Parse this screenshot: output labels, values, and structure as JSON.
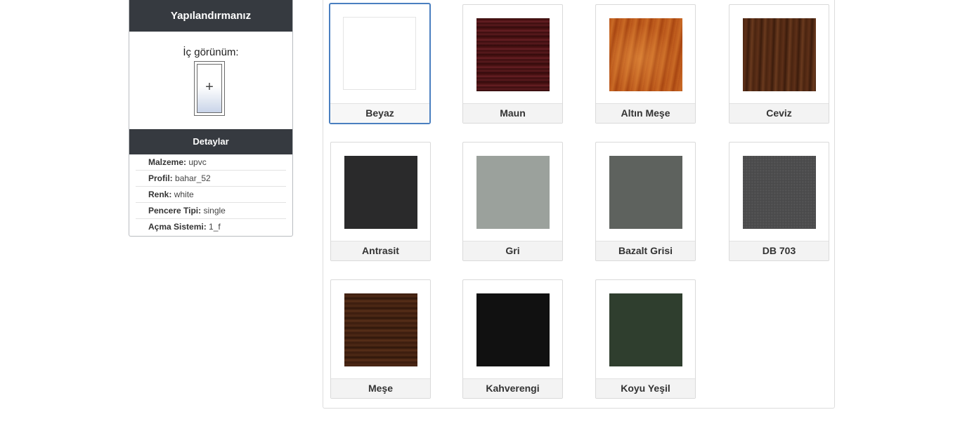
{
  "config": {
    "title": "Yapılandırmanız",
    "view_label": "İç görünüm:",
    "window_plus": "+",
    "details_title": "Detaylar",
    "details": [
      {
        "key": "Malzeme:",
        "value": "upvc"
      },
      {
        "key": "Profil:",
        "value": "bahar_52"
      },
      {
        "key": "Renk:",
        "value": "white"
      },
      {
        "key": "Pencere Tipi:",
        "value": "single"
      },
      {
        "key": "Açma Sistemi:",
        "value": "1_f"
      }
    ]
  },
  "colors": {
    "selected": "Beyaz",
    "items": [
      {
        "label": "Beyaz",
        "swatch": "#ffffff"
      },
      {
        "label": "Maun",
        "swatch": "#4a1214"
      },
      {
        "label": "Altın Meşe",
        "swatch": "#b8541a"
      },
      {
        "label": "Ceviz",
        "swatch": "#4a2410"
      },
      {
        "label": "Antrasit",
        "swatch": "#2a2a2b"
      },
      {
        "label": "Gri",
        "swatch": "#9ba19c"
      },
      {
        "label": "Bazalt Grisi",
        "swatch": "#5e625e"
      },
      {
        "label": "DB 703",
        "swatch": "#4a4a4b"
      },
      {
        "label": "Meşe",
        "swatch": "#3a1c0e"
      },
      {
        "label": "Kahverengi",
        "swatch": "#111111"
      },
      {
        "label": "Koyu Yeşil",
        "swatch": "#2f3e2e"
      }
    ]
  },
  "theme": {
    "header_bg": "#363a40",
    "selected_border": "#4a7fc0"
  }
}
